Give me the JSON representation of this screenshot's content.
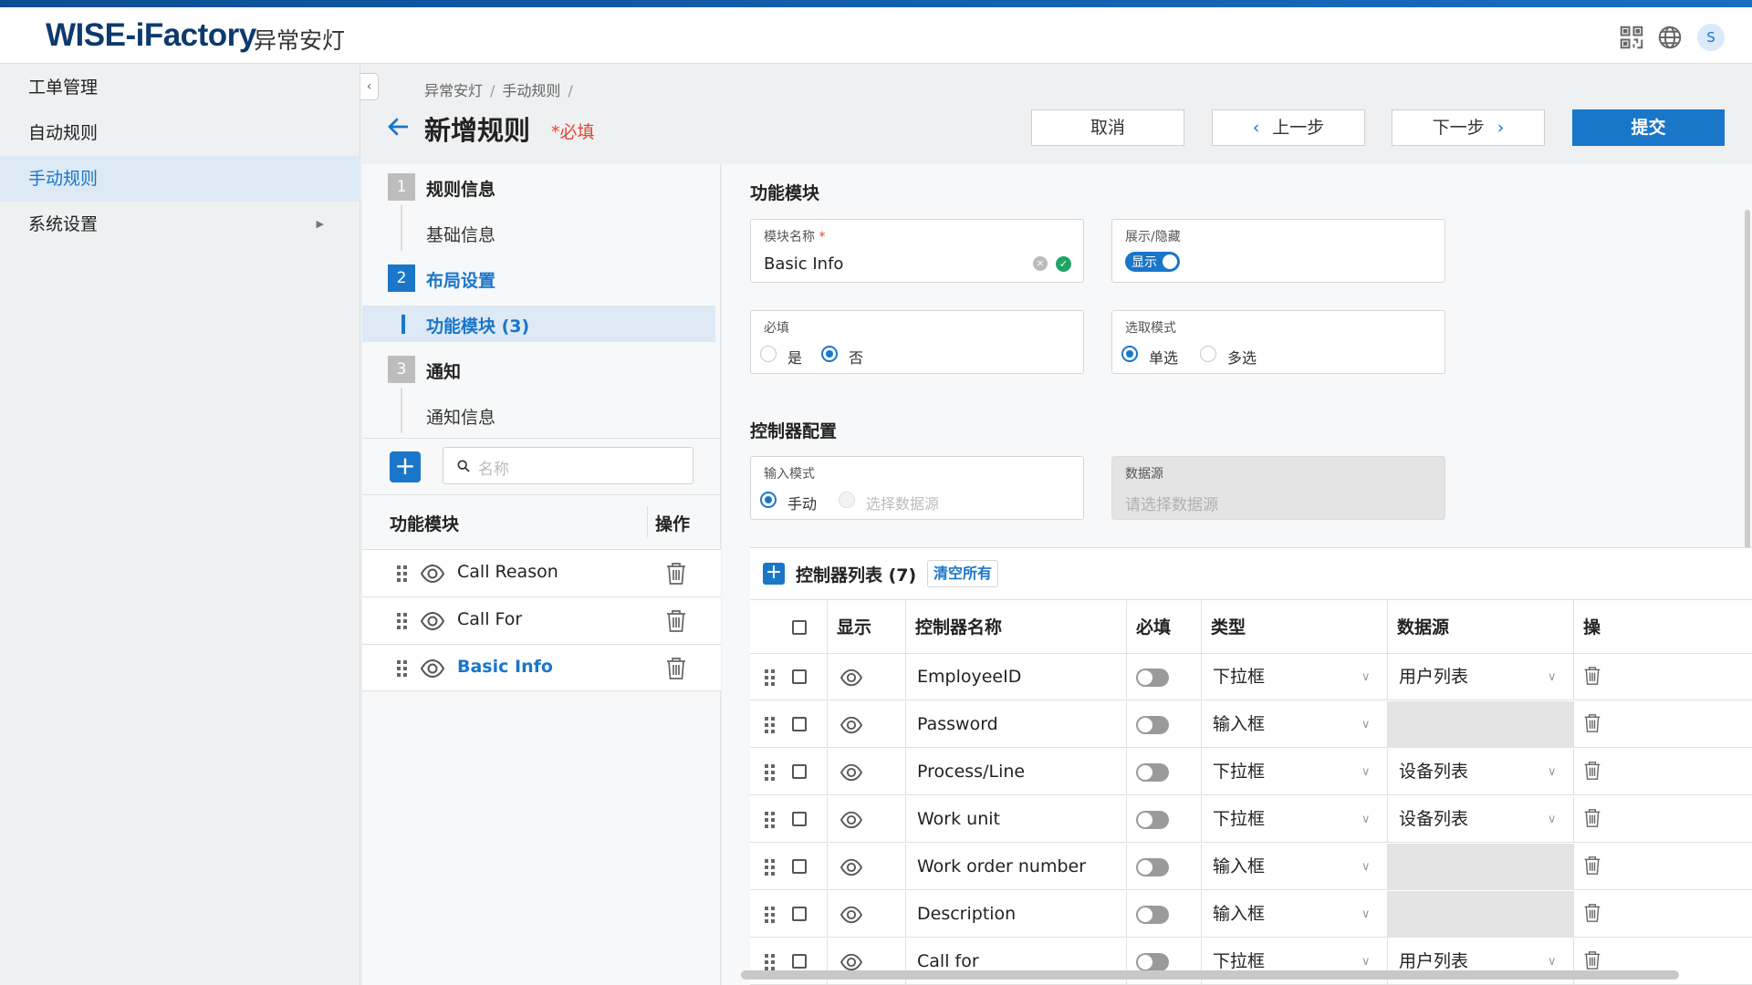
{
  "header": {
    "logo": "WISE-iFactory",
    "subtitle": "异常安灯",
    "avatar": "S"
  },
  "sidebar": {
    "items": [
      {
        "label": "工单管理"
      },
      {
        "label": "自动规则"
      },
      {
        "label": "手动规则"
      },
      {
        "label": "系统设置"
      }
    ]
  },
  "breadcrumb": {
    "items": [
      "异常安灯",
      "手动规则"
    ]
  },
  "page": {
    "title": "新增规则",
    "required_hint": "*必填"
  },
  "actions": {
    "cancel": "取消",
    "prev": "上一步",
    "next": "下一步",
    "submit": "提交"
  },
  "steps": [
    {
      "num": "1",
      "label": "规则信息",
      "sub": "基础信息"
    },
    {
      "num": "2",
      "label": "布局设置",
      "sub": "功能模块 (3)"
    },
    {
      "num": "3",
      "label": "通知",
      "sub": "通知信息"
    }
  ],
  "search": {
    "placeholder": "名称"
  },
  "module_list": {
    "col_module": "功能模块",
    "col_action": "操作",
    "rows": [
      {
        "name": "Call Reason"
      },
      {
        "name": "Call For"
      },
      {
        "name": "Basic Info"
      }
    ]
  },
  "module_form": {
    "section_title": "功能模块",
    "name_label": "模块名称",
    "name_value": "Basic Info",
    "display_label": "展示/隐藏",
    "display_toggle": "显示",
    "required_label": "必填",
    "required_yes": "是",
    "required_no": "否",
    "select_label": "选取模式",
    "select_single": "单选",
    "select_multi": "多选"
  },
  "controller_config": {
    "section_title": "控制器配置",
    "input_label": "输入模式",
    "input_manual": "手动",
    "input_ds": "选择数据源",
    "ds_label": "数据源",
    "ds_placeholder": "请选择数据源"
  },
  "controller_list": {
    "title": "控制器列表 (7)",
    "clear_all": "清空所有",
    "headers": {
      "display": "显示",
      "name": "控制器名称",
      "required": "必填",
      "type": "类型",
      "datasource": "数据源",
      "action": "操"
    },
    "rows": [
      {
        "name": "EmployeeID",
        "type": "下拉框",
        "datasource": "用户列表"
      },
      {
        "name": "Password",
        "type": "输入框",
        "datasource": ""
      },
      {
        "name": "Process/Line",
        "type": "下拉框",
        "datasource": "设备列表"
      },
      {
        "name": "Work unit",
        "type": "下拉框",
        "datasource": "设备列表"
      },
      {
        "name": "Work order number",
        "type": "输入框",
        "datasource": ""
      },
      {
        "name": "Description",
        "type": "输入框",
        "datasource": ""
      },
      {
        "name": "Call for",
        "type": "下拉框",
        "datasource": "用户列表"
      }
    ]
  },
  "colors": {
    "accent": "#1a76c9",
    "required": "#e8422d",
    "success": "#21a366"
  }
}
